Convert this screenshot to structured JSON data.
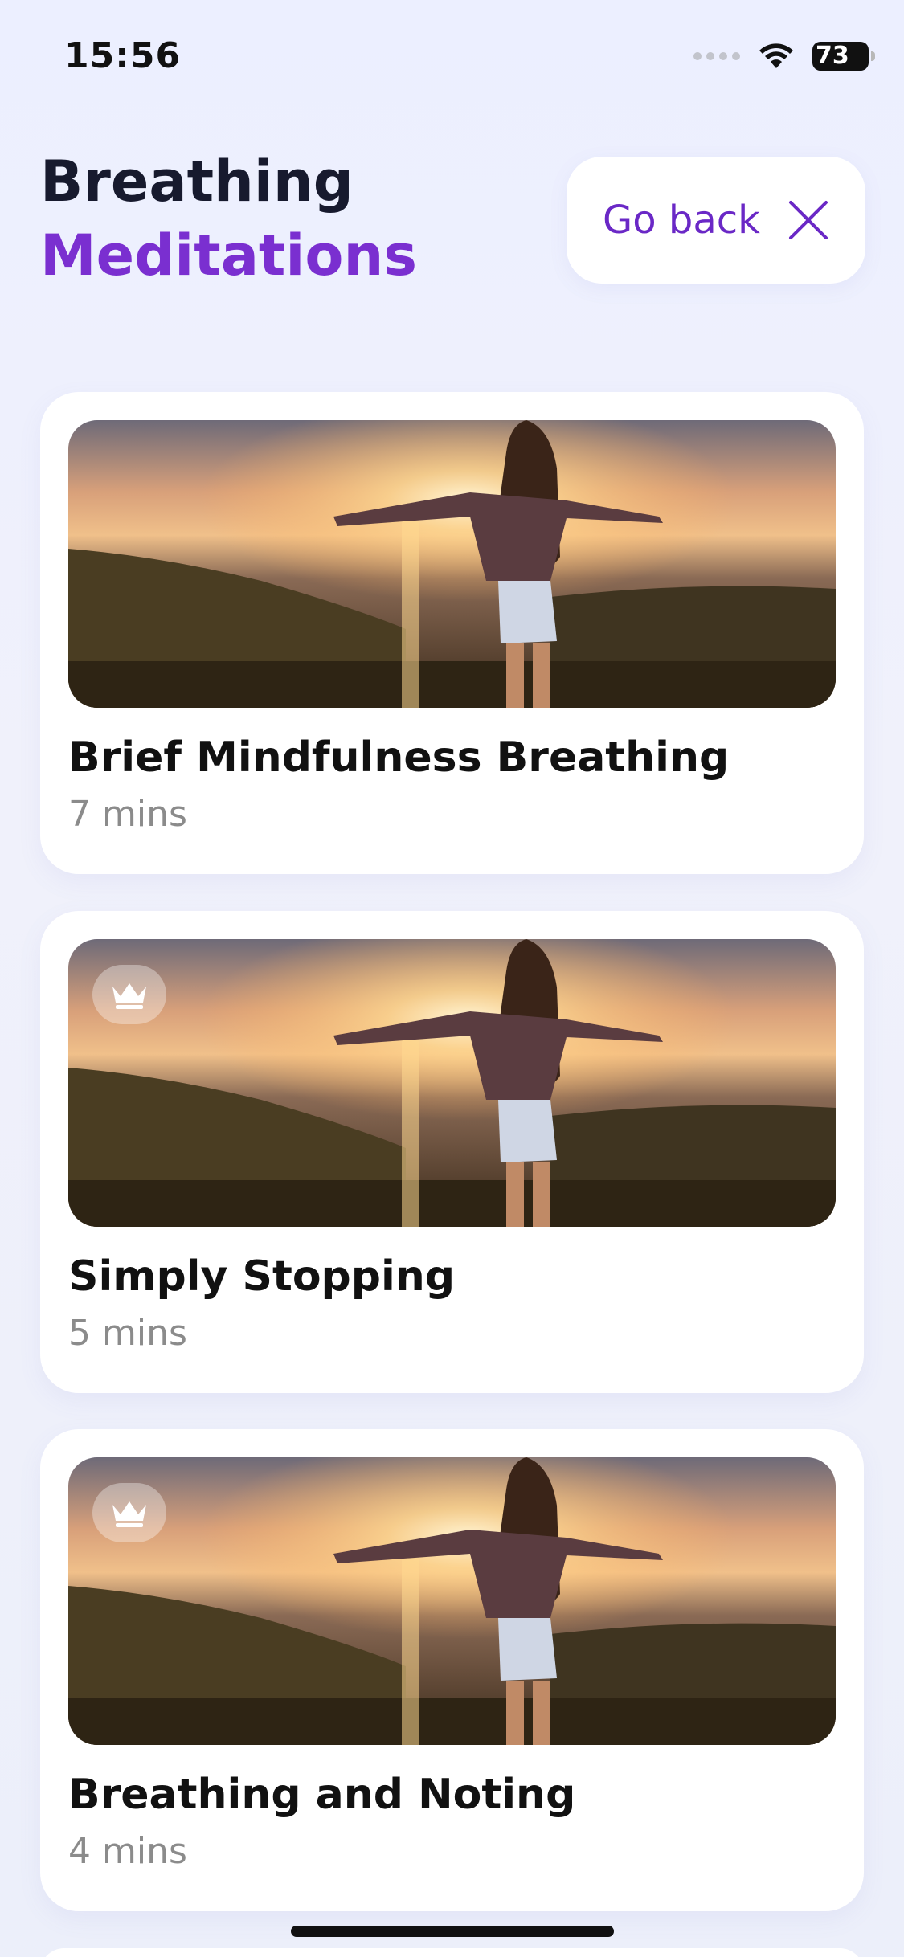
{
  "status_bar": {
    "time": "15:56",
    "battery": "73"
  },
  "header": {
    "title_line1": "Breathing",
    "title_line2": "Meditations",
    "go_back_label": "Go back"
  },
  "meditations": [
    {
      "title": "Brief Mindfulness Breathing",
      "duration": "7 mins",
      "premium": false
    },
    {
      "title": "Simply Stopping",
      "duration": "5 mins",
      "premium": true
    },
    {
      "title": "Breathing and Noting",
      "duration": "4 mins",
      "premium": true
    }
  ],
  "colors": {
    "accent_purple": "#7a2fd0",
    "title_dark": "#171a2e",
    "muted_text": "#8b8b8b",
    "background": "#eef0fb"
  }
}
